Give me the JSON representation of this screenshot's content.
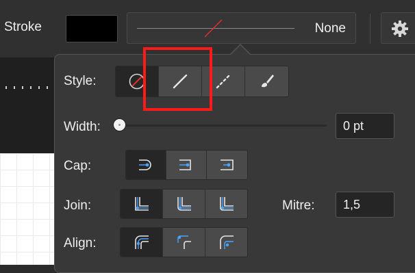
{
  "toolbar": {
    "stroke_label": "Stroke",
    "stroke_color": "#000000",
    "stroke_dropdown_value": "None",
    "gear_icon": "gear-icon"
  },
  "panel": {
    "style": {
      "label": "Style:",
      "options": [
        "no-stroke-icon",
        "solid-line-icon",
        "dashed-line-icon",
        "brush-icon"
      ],
      "selected": "no-stroke-icon"
    },
    "width": {
      "label": "Width:",
      "value": "0 pt",
      "slider_fraction": 0
    },
    "cap": {
      "label": "Cap:",
      "options": [
        "butt-cap-icon",
        "round-cap-icon",
        "square-cap-icon"
      ],
      "selected": "butt-cap-icon"
    },
    "join": {
      "label": "Join:",
      "options": [
        "miter-join-icon",
        "round-join-icon",
        "bevel-join-icon"
      ],
      "selected": "miter-join-icon"
    },
    "mitre": {
      "label": "Mitre:",
      "value": "1,5"
    },
    "align": {
      "label": "Align:",
      "options": [
        "align-inside-icon",
        "align-center-icon",
        "align-outside-icon"
      ],
      "selected": "align-inside-icon"
    }
  },
  "colors": {
    "highlight": "#ff1a1a",
    "accent_blue": "#4aa3ff",
    "no_stroke_red": "#e0302e"
  }
}
